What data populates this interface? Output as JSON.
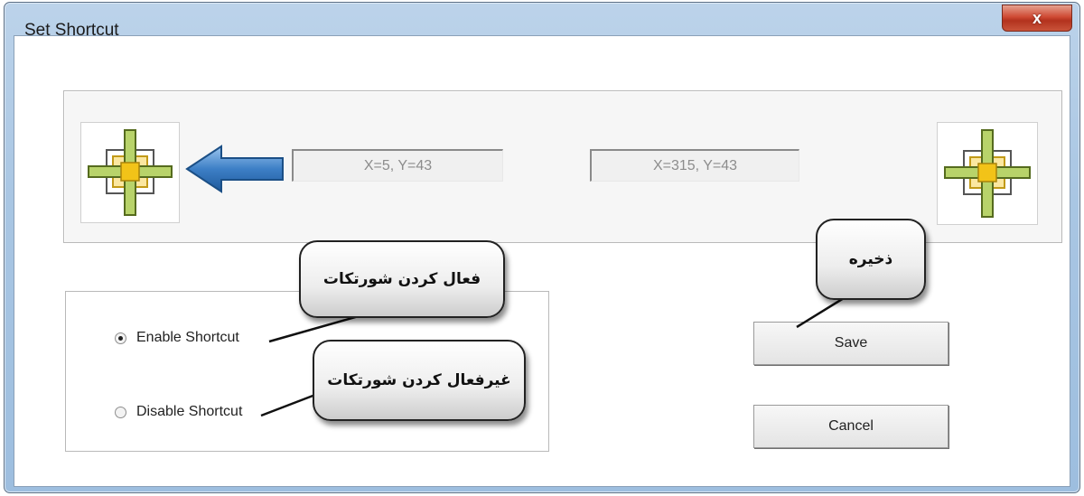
{
  "window": {
    "title": "Set Shortcut",
    "close_label": "x"
  },
  "coords": {
    "left": "X=5, Y=43",
    "right": "X=315, Y=43"
  },
  "options": {
    "enable_label": "Enable Shortcut",
    "disable_label": "Disable Shortcut",
    "selected": "enable"
  },
  "buttons": {
    "save_label": "Save",
    "cancel_label": "Cancel"
  },
  "callouts": {
    "enable": "فعال کردن شورتکات",
    "disable": "غیرفعال کردن شورتکات",
    "save": "ذخیره"
  },
  "colors": {
    "arrow": "#3d7fc6",
    "crosshair": "#b8d36a",
    "crosshair_center": "#f2c318"
  },
  "icons": {
    "crosshair": "crosshair-icon",
    "arrow": "left-arrow-icon",
    "close": "close-icon"
  }
}
